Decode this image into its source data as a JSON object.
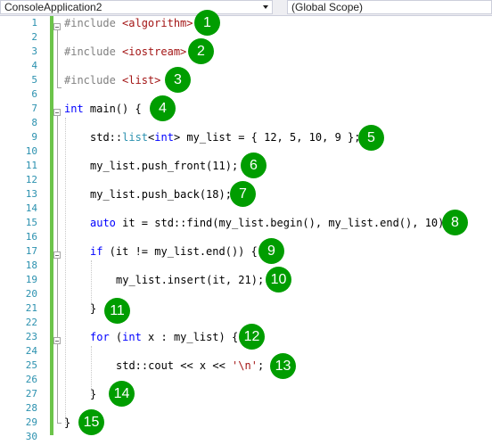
{
  "toolbar": {
    "project_dropdown": "ConsoleApplication2",
    "scope_dropdown": "(Global Scope)"
  },
  "line_numbers": [
    "1",
    "2",
    "3",
    "4",
    "5",
    "6",
    "7",
    "8",
    "9",
    "10",
    "11",
    "12",
    "13",
    "14",
    "15",
    "16",
    "17",
    "18",
    "19",
    "20",
    "21",
    "22",
    "23",
    "24",
    "25",
    "26",
    "27",
    "28",
    "29",
    "30"
  ],
  "code": {
    "l1": {
      "a": "#include ",
      "b": "<algorithm>"
    },
    "l3": {
      "a": "#include ",
      "b": "<iostream>"
    },
    "l5": {
      "a": "#include ",
      "b": "<list>"
    },
    "l7": {
      "a": "int",
      "b": " main() {"
    },
    "l9": {
      "a": "std::",
      "b": "list",
      "c": "<",
      "d": "int",
      "e": "> my_list = { 12, 5, 10, 9 };"
    },
    "l11": "my_list.push_front(11);",
    "l13": "my_list.push_back(18);",
    "l15": {
      "a": "auto",
      "b": " it = std::find(my_list.begin(), my_list.end(), 10);"
    },
    "l17": {
      "a": "if",
      "b": " (it != my_list.end()) {"
    },
    "l19": "my_list.insert(it, 21);",
    "l21": "}",
    "l23": {
      "a": "for",
      "b": " (",
      "c": "int",
      "d": " x : my_list) {"
    },
    "l25": {
      "a": "std::cout << x << ",
      "b": "'\\n'",
      "c": ";"
    },
    "l27": "}",
    "l29": "}"
  },
  "badges": [
    "1",
    "2",
    "3",
    "4",
    "5",
    "6",
    "7",
    "8",
    "9",
    "10",
    "11",
    "12",
    "13",
    "14",
    "15"
  ],
  "colors": {
    "badge": "#009d00",
    "keyword": "#0000ff",
    "type": "#2b91af",
    "string": "#a31515",
    "preprocessor": "#808080",
    "line_number": "#2b91af",
    "change_bar": "#6cc44a"
  }
}
